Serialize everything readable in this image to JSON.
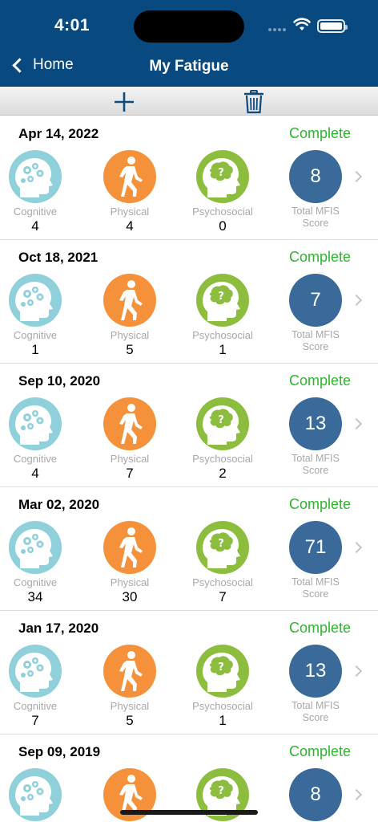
{
  "status_bar": {
    "time": "4:01"
  },
  "nav": {
    "back_label": "Home",
    "title": "My Fatigue"
  },
  "toolbar": {
    "add_icon": "plus-icon",
    "delete_icon": "trash-icon"
  },
  "labels": {
    "cognitive": "Cognitive",
    "physical": "Physical",
    "psychosocial": "Psychosocial",
    "total_line1": "Total MFIS",
    "total_line2": "Score"
  },
  "colors": {
    "nav_bg": "#084a80",
    "complete": "#2db52d",
    "cognitive": "#8fd0da",
    "physical": "#f5913a",
    "psychosocial": "#8cbd3f",
    "total": "#3a6a9a"
  },
  "entries": [
    {
      "date": "Apr 14, 2022",
      "status": "Complete",
      "cognitive": "4",
      "physical": "4",
      "psychosocial": "0",
      "total": "8"
    },
    {
      "date": "Oct 18, 2021",
      "status": "Complete",
      "cognitive": "1",
      "physical": "5",
      "psychosocial": "1",
      "total": "7"
    },
    {
      "date": "Sep 10, 2020",
      "status": "Complete",
      "cognitive": "4",
      "physical": "7",
      "psychosocial": "2",
      "total": "13"
    },
    {
      "date": "Mar 02, 2020",
      "status": "Complete",
      "cognitive": "34",
      "physical": "30",
      "psychosocial": "7",
      "total": "71"
    },
    {
      "date": "Jan 17, 2020",
      "status": "Complete",
      "cognitive": "7",
      "physical": "5",
      "psychosocial": "1",
      "total": "13"
    },
    {
      "date": "Sep 09, 2019",
      "status": "Complete",
      "cognitive": "",
      "physical": "",
      "psychosocial": "",
      "total": "8"
    }
  ]
}
